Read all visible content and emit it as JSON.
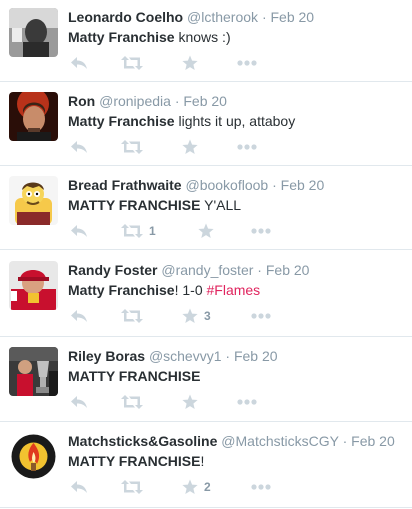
{
  "icons": {
    "reply": "reply-icon",
    "retweet": "retweet-icon",
    "favorite": "star-icon",
    "more": "more-dots-icon"
  },
  "colors": {
    "icon": "#ccd6dd",
    "meta": "#8899a6",
    "hashtag": "#e0245e",
    "divider": "#e1e8ed"
  },
  "tweets": [
    {
      "name": "Leonardo Coelho",
      "handle": "@lctherook",
      "separator": "·",
      "date": "Feb 20",
      "text_bold": "Matty Franchise",
      "text_rest": " knows :)",
      "hashtag": "",
      "retweet_count": "",
      "favorite_count": ""
    },
    {
      "name": "Ron",
      "handle": "@ronipedia",
      "separator": "·",
      "date": "Feb 20",
      "text_bold": "Matty Franchise",
      "text_rest": " lights it up, attaboy",
      "hashtag": "",
      "retweet_count": "",
      "favorite_count": ""
    },
    {
      "name": "Bread Frathwaite",
      "handle": "@bookofloob",
      "separator": "·",
      "date": "Feb 20",
      "text_bold": "MATTY FRANCHISE",
      "text_rest": " Y'ALL",
      "hashtag": "",
      "retweet_count": "1",
      "favorite_count": ""
    },
    {
      "name": "Randy Foster",
      "handle": "@randy_foster",
      "separator": "·",
      "date": "Feb 20",
      "text_bold": "Matty Franchise",
      "text_rest": "! 1-0 ",
      "hashtag": "#Flames",
      "retweet_count": "",
      "favorite_count": "3"
    },
    {
      "name": "Riley Boras",
      "handle": "@schevvy1",
      "separator": "·",
      "date": "Feb 20",
      "text_bold": "MATTY FRANCHISE",
      "text_rest": "",
      "hashtag": "",
      "retweet_count": "",
      "favorite_count": ""
    },
    {
      "name": "Matchsticks&Gasoline",
      "handle": "@MatchsticksCGY",
      "separator": "·",
      "date": "Feb 20",
      "text_bold": "MATTY FRANCHISE",
      "text_rest": "!",
      "hashtag": "",
      "retweet_count": "",
      "favorite_count": "2"
    }
  ]
}
